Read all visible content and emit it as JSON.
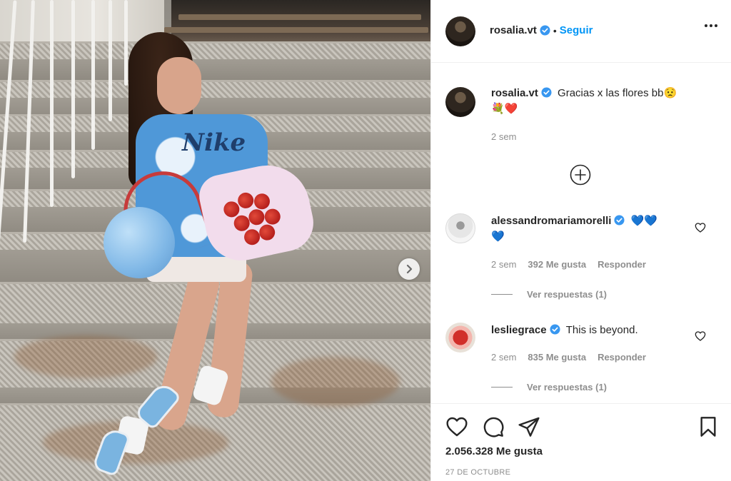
{
  "post": {
    "author": "rosalia.vt",
    "follow_label": "Seguir",
    "separator": "•",
    "caption": "Gracias x las flores bb",
    "caption_emojis": "😟",
    "caption_emojis_line2": "💐❤️",
    "caption_time": "2 sem",
    "likes_label": "2.056.328 Me gusta",
    "date_label": "27 DE OCTUBRE"
  },
  "photo": {
    "shirt_text": "Nike"
  },
  "comments": [
    {
      "username": "alessandromariamorelli",
      "text": "💙💙",
      "text_line2": "💙",
      "time": "2 sem",
      "likes": "392 Me gusta",
      "reply_label": "Responder",
      "view_replies": "Ver respuestas (1)"
    },
    {
      "username": "lesliegrace",
      "text": "This is beyond.",
      "time": "2 sem",
      "likes": "835 Me gusta",
      "reply_label": "Responder",
      "view_replies": "Ver respuestas (1)"
    }
  ],
  "icons": {
    "verified": "verified-badge-icon",
    "more": "more-options-icon",
    "add_comment": "plus-circle-icon",
    "like": "heart-icon",
    "comment": "comment-bubble-icon",
    "share": "paper-plane-icon",
    "save": "bookmark-icon",
    "next": "chevron-right-icon"
  },
  "colors": {
    "accent": "#0095f6",
    "verified": "#3897f0",
    "text": "#262626",
    "muted": "#8e8e8e"
  }
}
